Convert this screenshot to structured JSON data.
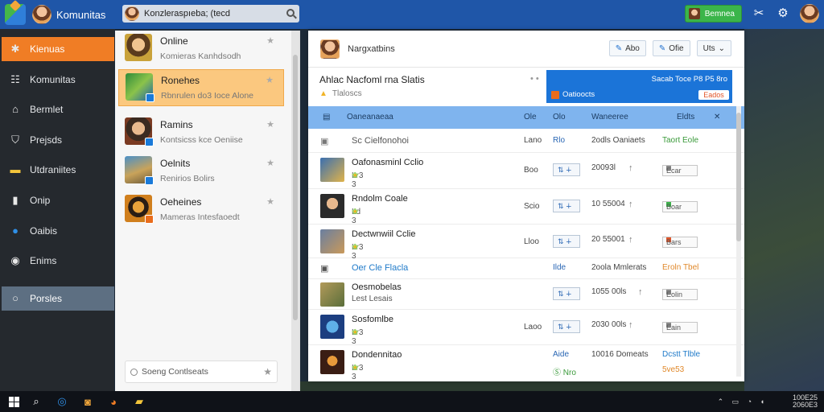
{
  "topbar": {
    "app_title": "Komunitas",
    "search_value": "Konzleraspıeba; (tecd",
    "action_button_label": "Bemnea",
    "icons": [
      "puzzle-icon",
      "gear-icon"
    ]
  },
  "sidebar": {
    "items": [
      {
        "label": "Kienuas",
        "icon": "star-icon",
        "state": "active"
      },
      {
        "label": "Komunitas",
        "icon": "people-icon",
        "state": "normal"
      },
      {
        "label": "Bermlet",
        "icon": "home-icon",
        "state": "normal"
      },
      {
        "label": "Prejsds",
        "icon": "shield-icon",
        "state": "normal"
      },
      {
        "label": "Utdraniites",
        "icon": "folder-icon",
        "state": "normal"
      },
      {
        "label": "Onip",
        "icon": "book-icon",
        "state": "normal"
      },
      {
        "label": "Oaibis",
        "icon": "circle-icon",
        "state": "normal"
      },
      {
        "label": "Enims",
        "icon": "globe-icon",
        "state": "normal"
      },
      {
        "label": "Porsles",
        "icon": "ring-icon",
        "state": "selected"
      }
    ]
  },
  "list": {
    "items": [
      {
        "title": "Online",
        "subtitle": "Komieras Kanhdsodh"
      },
      {
        "title": "Ronehes",
        "subtitle": "Rbnrulen do3 Ioce Alone"
      },
      {
        "title": "Ramins",
        "subtitle": "Kontsicss kce Oeniise"
      },
      {
        "title": "Oelnits",
        "subtitle": "Renirios Bolirs"
      },
      {
        "title": "Oeheines",
        "subtitle": "Mameras Intesfaoedt"
      }
    ],
    "search_placeholder": "Soeng Contlseats"
  },
  "panel": {
    "header_title": "Nargxatbins",
    "buttons": [
      "Abo",
      "Ofie",
      "Uts"
    ],
    "info_title": "Ahlac Nacfoml rna Slatis",
    "info_subtitle": "Tlaloscs",
    "banner_top": "Sacab Toce P8 P5 8ro",
    "banner_bottom": "Oatioocts",
    "banner_badge": "Eados",
    "table_headers": [
      "Oaneanaeaa",
      "Ole",
      "Olo",
      "Waneeree",
      "Eldts"
    ],
    "rows": [
      {
        "title": "Sc Cielfonohoi",
        "date": "Lano",
        "step": "Rlo",
        "dl": "2odls Oaniaets",
        "status": "Taort Eole",
        "type": "group"
      },
      {
        "title": "Oafonasminl Cclio",
        "sub": "Lr3 3",
        "date": "Boo",
        "dl": "20093l",
        "tag": "Ecar"
      },
      {
        "title": "Rndolm Coale",
        "sub": "Ld 3",
        "date": "Scio",
        "dl": "10 55004",
        "tag": "Boar"
      },
      {
        "title": "Dectwnwiil Cclie",
        "sub": "Lr3 3",
        "date": "Lloo",
        "dl": "20 55001",
        "tag": "Bars"
      },
      {
        "title": "Oer Cle Flacla",
        "date": "",
        "step": "Ilde",
        "dl": "2oola Mmlerats",
        "status": "Eroln Tbel",
        "type": "group"
      },
      {
        "title": "Oesmobelas",
        "sub": "Lest Lesais",
        "date": "",
        "dl": "1055 00ls",
        "tag": "Eolin"
      },
      {
        "title": "Sosfomlbe",
        "sub": "Lr3 3",
        "date": "Laoo",
        "dl": "2030 00ls",
        "tag": "Eain"
      },
      {
        "title": "Dondennitao",
        "sub": "Lr3 3",
        "date": "",
        "step": "Aide",
        "dl": "10016 Domeats",
        "status": "Dcstt Tlble",
        "status2": "5ve53",
        "type": "group2"
      }
    ]
  },
  "taskbar": {
    "time": "100E25",
    "date": "2060E3"
  }
}
